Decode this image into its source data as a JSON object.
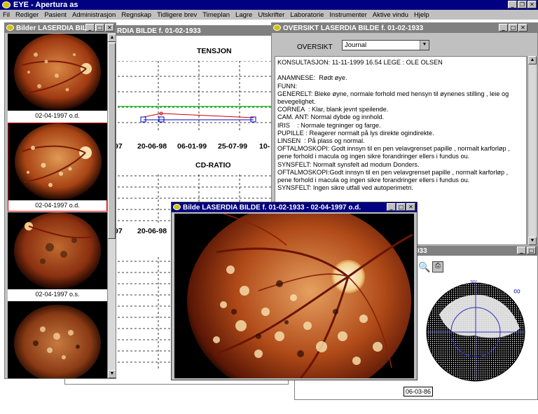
{
  "app": {
    "title": "EYE - Apertura as",
    "menu": [
      "Fil",
      "Rediger",
      "Pasient",
      "Administrasjon",
      "Regnskap",
      "Tidligere brev",
      "Timeplan",
      "Lagre",
      "Utskrifter",
      "Laboratorie",
      "Instrumenter",
      "Aktive vindu",
      "Hjelp"
    ]
  },
  "chart_window": {
    "title": "RDIA BILDE  f. 01-02-1933",
    "tensjon_title": "TENSJON",
    "cdratio_title": "CD-RATIO",
    "dates_top": [
      "97",
      "20-06-98",
      "06-01-99",
      "25-07-99",
      "10-"
    ],
    "dates_mid": [
      "97",
      "20-06-98"
    ]
  },
  "bilder": {
    "title": "Bilder LASERDIA BILDE",
    "thumbs": [
      {
        "label": "02-04-1997 o.d."
      },
      {
        "label": "02-04-1997 o.d."
      },
      {
        "label": "02-04-1997 o.s."
      },
      {
        "label": ""
      }
    ]
  },
  "oversikt": {
    "title": "OVERSIKT LASERDIA BILDE  f. 01-02-1933",
    "label": "OVERSIKT",
    "select_value": "Journal",
    "lines": [
      "KONSULTASJON: 11-11-1999 16.54 LEGE : OLE OLSEN",
      "",
      "ANAMNESE:  Rødt øye.",
      "FUNN:",
      "GENERELT: Bleke øyne, normale forhold med hensyn til øynenes stilling , leie og bevegelighet.",
      "CORNEA  : Klar, blank jevnt speilende.",
      "CAM. ANT: Normal dybde og innhold.",
      "IRIS    : Normale tegninger og farge.",
      "PUPILLE : Reagerer normalt på lys direkte ogindirekte.",
      "LINSEN  : På plass og normal.",
      "OFTALMOSKOPI: Godt innsyn til en pen velavgrenset papille , normalt karforløp , pene forhold i macula og ingen sikre forandringer ellers i fundus ou.",
      "SYNSFELT: Normalt synsfelt ad modum Donders.",
      "OFTALMOSKOPI:Godt innsyn til en pen velavgrenset papille , normalt karforløp , pene forhold i macula og ingen sikre forandringer ellers i fundus ou.",
      "SYNSFELT: Ingen sikre utfall ved autoperimetri."
    ]
  },
  "big_image": {
    "title": "Bilde LASERDIA BILDE  f. 01-02-1933 - 02-04-1997 o.d."
  },
  "visual_field": {
    "title_fragment": "933",
    "degree_label": "30°",
    "infinity_label": "∞",
    "date": "06-03-86"
  }
}
